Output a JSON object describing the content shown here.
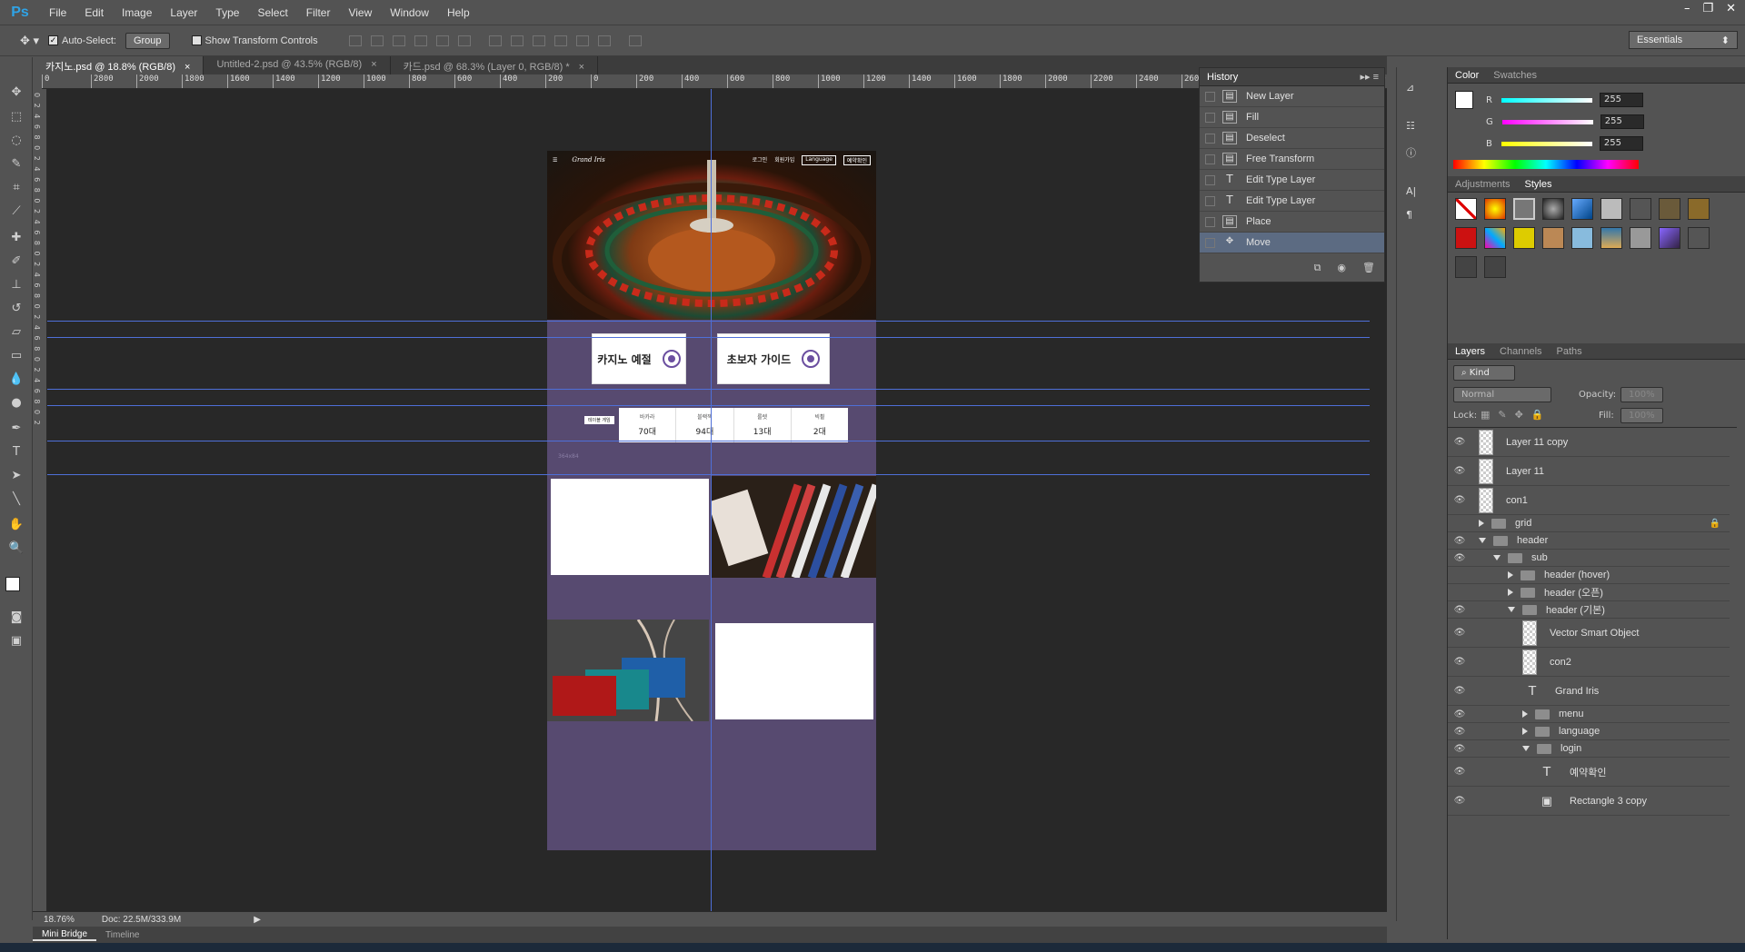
{
  "app": {
    "logo": "Ps"
  },
  "menu": [
    "File",
    "Edit",
    "Image",
    "Layer",
    "Type",
    "Select",
    "Filter",
    "View",
    "Window",
    "Help"
  ],
  "window_controls": [
    "–",
    "❐",
    "✕"
  ],
  "options": {
    "auto_select_label": "Auto-Select:",
    "group_value": "Group",
    "transform_label": "Show Transform Controls",
    "workspace": "Essentials"
  },
  "tabs": [
    {
      "label": "카지노.psd @ 18.8% (RGB/8)",
      "close": "×"
    },
    {
      "label": "Untitled-2.psd @ 43.5% (RGB/8)",
      "close": "×"
    },
    {
      "label": "카드.psd @ 68.3% (Layer 0, RGB/8) *",
      "close": "×"
    }
  ],
  "ruler_h": [
    "0",
    "2800",
    "2000",
    "1800",
    "1600",
    "1400",
    "1200",
    "1000",
    "800",
    "600",
    "400",
    "200",
    "0",
    "200",
    "400",
    "600",
    "800",
    "1000",
    "1200",
    "1400",
    "1600",
    "1800",
    "2000",
    "2200",
    "2400",
    "2600",
    "2800",
    "3000",
    "3200",
    "3400",
    "3600"
  ],
  "doc": {
    "nav_brand": "Grand Iris",
    "nav_links": [
      "로그인",
      "회원가입",
      "Language",
      "예약확인"
    ],
    "btn1": "카지노 예절",
    "btn2": "초보자 가이드",
    "small_label": "테이블 게임",
    "stats": [
      {
        "label": "바카라",
        "value": "70대"
      },
      {
        "label": "블랙잭",
        "value": "94대"
      },
      {
        "label": "룰렛",
        "value": "13대"
      },
      {
        "label": "빅휠",
        "value": "2대"
      }
    ],
    "tiny_text": "364x84"
  },
  "history": {
    "title": "History",
    "items": [
      {
        "label": "New Layer",
        "icon": "▤"
      },
      {
        "label": "Fill",
        "icon": "▤"
      },
      {
        "label": "Deselect",
        "icon": "▤"
      },
      {
        "label": "Free Transform",
        "icon": "▤"
      },
      {
        "label": "Edit Type Layer",
        "icon": "T"
      },
      {
        "label": "Edit Type Layer",
        "icon": "T"
      },
      {
        "label": "Place",
        "icon": "▤"
      },
      {
        "label": "Move",
        "icon": "✥"
      }
    ]
  },
  "color_panel": {
    "tab1": "Color",
    "tab2": "Swatches",
    "r_label": "R",
    "g_label": "G",
    "b_label": "B",
    "r": "255",
    "g": "255",
    "b": "255"
  },
  "styles_panel": {
    "tab1": "Adjustments",
    "tab2": "Styles"
  },
  "layers_panel": {
    "tab1": "Layers",
    "tab2": "Channels",
    "tab3": "Paths",
    "kind": "Kind",
    "blend": "Normal",
    "opacity_label": "Opacity:",
    "opacity": "100%",
    "lock_label": "Lock:",
    "fill_label": "Fill:",
    "fill": "100%",
    "layers": [
      {
        "name": "Layer 11 copy",
        "type": "thumb",
        "indent": 0
      },
      {
        "name": "Layer 11",
        "type": "thumb",
        "indent": 0
      },
      {
        "name": "con1",
        "type": "thumb",
        "indent": 0
      },
      {
        "name": "grid",
        "type": "folder-closed",
        "indent": 0
      },
      {
        "name": "header",
        "type": "folder-open",
        "indent": 0
      },
      {
        "name": "sub",
        "type": "folder-open",
        "indent": 1
      },
      {
        "name": "header (hover)",
        "type": "folder-closed",
        "indent": 2
      },
      {
        "name": "header (오픈)",
        "type": "folder-closed",
        "indent": 2
      },
      {
        "name": "header (기본)",
        "type": "folder-open",
        "indent": 2
      },
      {
        "name": "Vector Smart Object",
        "type": "thumb",
        "indent": 3
      },
      {
        "name": "con2",
        "type": "thumb",
        "indent": 3
      },
      {
        "name": "Grand Iris",
        "type": "text",
        "indent": 3
      },
      {
        "name": "menu",
        "type": "folder-closed",
        "indent": 3
      },
      {
        "name": "language",
        "type": "folder-closed",
        "indent": 3
      },
      {
        "name": "login",
        "type": "folder-open",
        "indent": 3
      },
      {
        "name": "예약확인",
        "type": "text",
        "indent": 4
      },
      {
        "name": "Rectangle 3 copy",
        "type": "shape",
        "indent": 4
      }
    ]
  },
  "status": {
    "zoom": "18.76%",
    "doc": "Doc: 22.5M/333.9M"
  },
  "bottom_tabs": [
    "Mini Bridge",
    "Timeline"
  ]
}
